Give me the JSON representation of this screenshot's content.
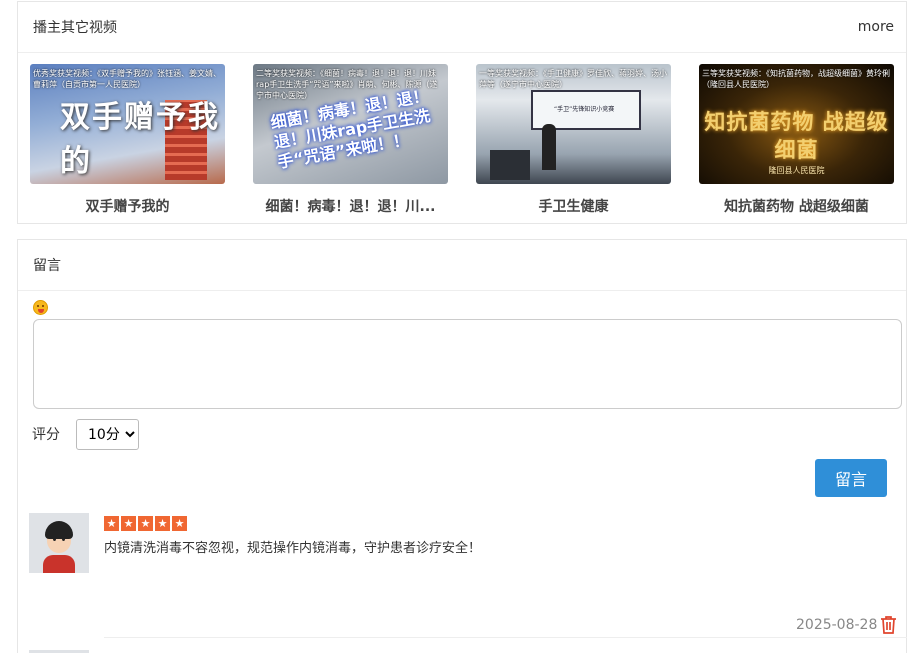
{
  "videos_panel": {
    "title": "播主其它视频",
    "more_label": "more",
    "videos": [
      {
        "title": "双手赠予我的",
        "thumb_caption": "优秀奖获奖视频：《双手赠予我的》张钰涵、姜文婧、曹莉萍（自贡市第一人民医院）",
        "thumb_text": "双手赠予我的"
      },
      {
        "title": "细菌！病毒！退！退！川...",
        "thumb_caption": "二等奖获奖视频：《细菌！病毒！退！退！退！川妹rap手卫生洗手“咒语”来啦》肖萌、何彬、陈源（遂宁市中心医院）",
        "thumb_text": "细菌！病毒！退！退！退！川妹rap手卫生洗手“咒语”来啦！！"
      },
      {
        "title": "手卫生健康",
        "thumb_caption": "一等奖获奖视频：《手卫健康》罗佳欣、蒋羽婷、汤小萍等（遂宁市中心医院）",
        "thumb_text": "“手卫”先锋知识小竞赛"
      },
      {
        "title": "知抗菌药物 战超级细菌",
        "thumb_caption": "三等奖获奖视频：《知抗菌药物，战超级细菌》黄玲俐（隆回县人民医院）",
        "thumb_text": "知抗菌药物 战超级细菌",
        "thumb_subtext": "隆回县人民医院"
      }
    ]
  },
  "comments_panel": {
    "title": "留言",
    "emoji_icon": "grinning-face-icon",
    "textarea_value": "",
    "rating_label": "评分",
    "rating_selected": "10分",
    "submit_label": "留言",
    "comments": [
      {
        "stars": 5,
        "star_glyph": "★",
        "text": "内镜清洗消毒不容忽视，规范操作内镜消毒，守护患者诊疗安全！",
        "date": "2025-08-28",
        "delete_icon": "trash-icon",
        "delete_color": "#e0442d"
      }
    ]
  },
  "colors": {
    "primary": "#2f8fd8",
    "star": "#f06732",
    "danger": "#e0442d"
  }
}
